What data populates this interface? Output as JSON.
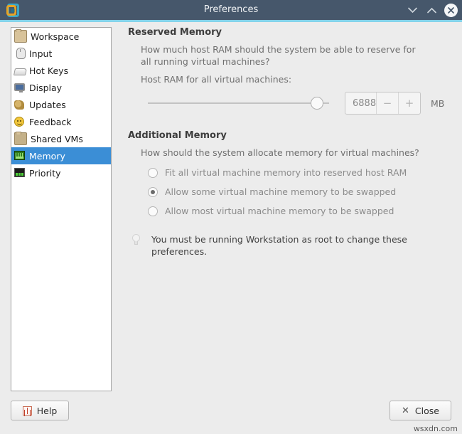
{
  "window": {
    "title": "Preferences",
    "app_icon": "vmware-workstation-icon",
    "controls": {
      "minimize": "⌄",
      "maximize": "⌃",
      "close": "✕"
    }
  },
  "sidebar": {
    "items": [
      {
        "label": "Workspace",
        "icon": "folder-icon",
        "selected": false
      },
      {
        "label": "Input",
        "icon": "mouse-icon",
        "selected": false
      },
      {
        "label": "Hot Keys",
        "icon": "keyboard-icon",
        "selected": false
      },
      {
        "label": "Display",
        "icon": "monitor-icon",
        "selected": false
      },
      {
        "label": "Updates",
        "icon": "updates-icon",
        "selected": false
      },
      {
        "label": "Feedback",
        "icon": "smiley-icon",
        "selected": false
      },
      {
        "label": "Shared VMs",
        "icon": "folder-icon",
        "selected": false
      },
      {
        "label": "Memory",
        "icon": "memory-chip-icon",
        "selected": true
      },
      {
        "label": "Priority",
        "icon": "chart-icon",
        "selected": false
      }
    ]
  },
  "main": {
    "reserved_memory": {
      "title": "Reserved Memory",
      "description": "How much host RAM should the system be able to reserve for all running virtual machines?",
      "slider_label": "Host RAM for all virtual machines:",
      "slider_percent": 91,
      "spin_value": "6888",
      "spin_minus": "−",
      "spin_plus": "+",
      "unit": "MB"
    },
    "additional_memory": {
      "title": "Additional Memory",
      "description": "How should the system allocate memory for virtual machines?",
      "options": [
        {
          "label": "Fit all virtual machine memory into reserved host RAM",
          "selected": false
        },
        {
          "label": "Allow some virtual machine memory to be swapped",
          "selected": true
        },
        {
          "label": "Allow most virtual machine memory to be swapped",
          "selected": false
        }
      ]
    },
    "note": {
      "icon": "lightbulb-icon",
      "text": "You must be running Workstation as root to change these preferences."
    }
  },
  "footer": {
    "help_label": "Help",
    "help_icon": "help-icon",
    "close_label": "Close",
    "close_icon": "close-x-icon"
  },
  "watermark": "wsxdn.com",
  "colors": {
    "titlebar": "#46576b",
    "accent_line": "#84d3ea",
    "selection": "#3b8ed6",
    "background": "#ececec"
  }
}
